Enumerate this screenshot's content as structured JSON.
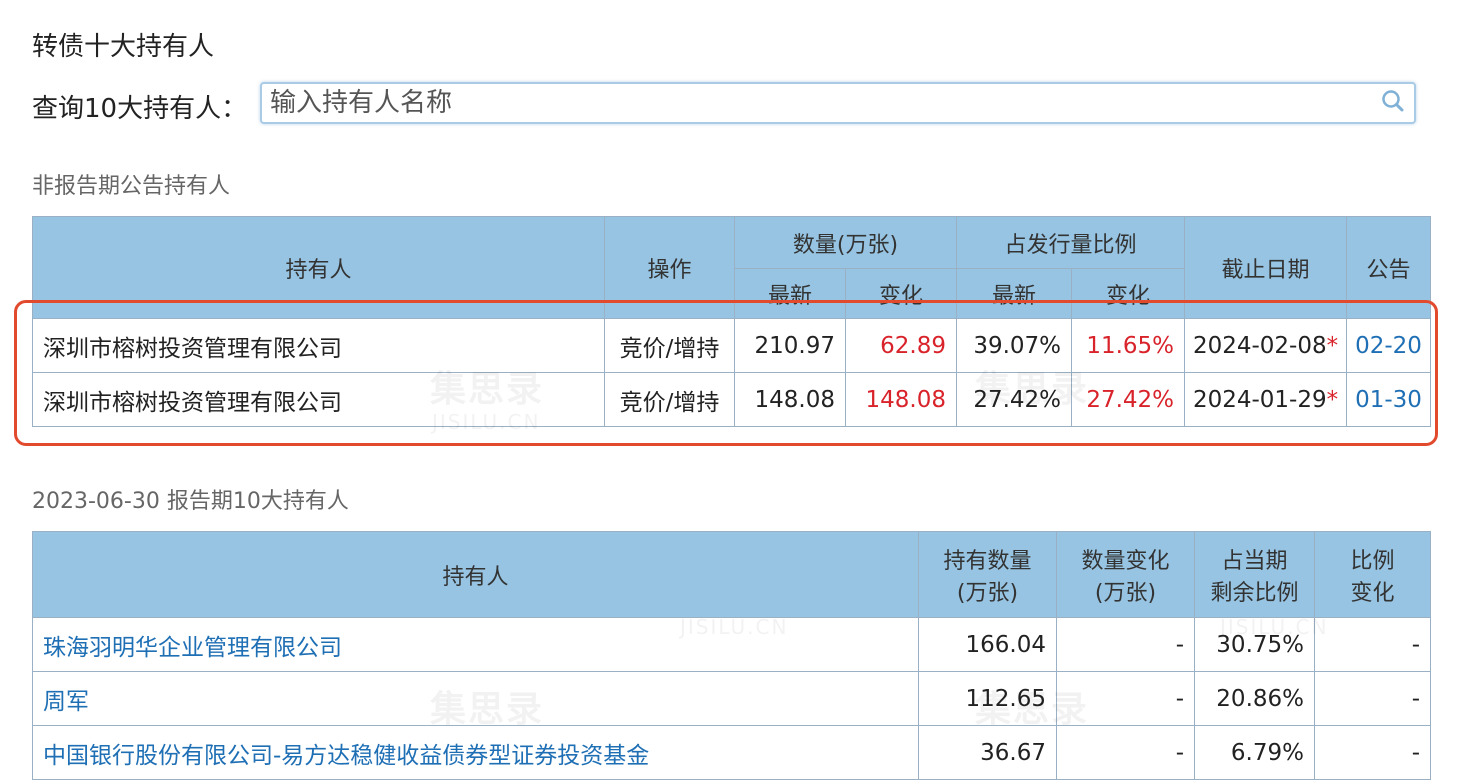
{
  "page_title": "转债十大持有人",
  "query": {
    "label": "查询10大持有人：",
    "placeholder": "输入持有人名称",
    "search_icon": "search-icon"
  },
  "non_report": {
    "section_title": "非报告期公告持有人",
    "headers": {
      "holder": "持有人",
      "action": "操作",
      "quantity": "数量(万张)",
      "ratio": "占发行量比例",
      "latest": "最新",
      "change": "变化",
      "deadline": "截止日期",
      "notice": "公告"
    },
    "rows": [
      {
        "holder": "深圳市榕树投资管理有限公司",
        "action": "竞价/增持",
        "qty_latest": "210.97",
        "qty_change": "62.89",
        "ratio_latest": "39.07%",
        "ratio_change": "11.65%",
        "date": "2024-02-08",
        "star": "*",
        "notice": "02-20"
      },
      {
        "holder": "深圳市榕树投资管理有限公司",
        "action": "竞价/增持",
        "qty_latest": "148.08",
        "qty_change": "148.08",
        "ratio_latest": "27.42%",
        "ratio_change": "27.42%",
        "date": "2024-01-29",
        "star": "*",
        "notice": "01-30"
      }
    ]
  },
  "report": {
    "section_title": "2023-06-30 报告期10大持有人",
    "headers": {
      "holder": "持有人",
      "qty_line1": "持有数量",
      "qty_line2": "(万张)",
      "change_line1": "数量变化",
      "change_line2": "(万张)",
      "ratio_line1": "占当期",
      "ratio_line2": "剩余比例",
      "ratio_change_line1": "比例",
      "ratio_change_line2": "变化"
    },
    "rows": [
      {
        "holder": "珠海羽明华企业管理有限公司",
        "qty": "166.04",
        "change": "-",
        "ratio": "30.75%",
        "ratio_change": "-"
      },
      {
        "holder": "周军",
        "qty": "112.65",
        "change": "-",
        "ratio": "20.86%",
        "ratio_change": "-"
      },
      {
        "holder": "中国银行股份有限公司-易方达稳健收益债券型证券投资基金",
        "qty": "36.67",
        "change": "-",
        "ratio": "6.79%",
        "ratio_change": "-"
      }
    ]
  },
  "watermark": {
    "text": "集思录",
    "sub": "JISILU.CN"
  },
  "colors": {
    "header_bg": "#96c4e2",
    "red": "#d9232b",
    "link": "#1f6fb5",
    "highlight": "#e24a2e"
  }
}
